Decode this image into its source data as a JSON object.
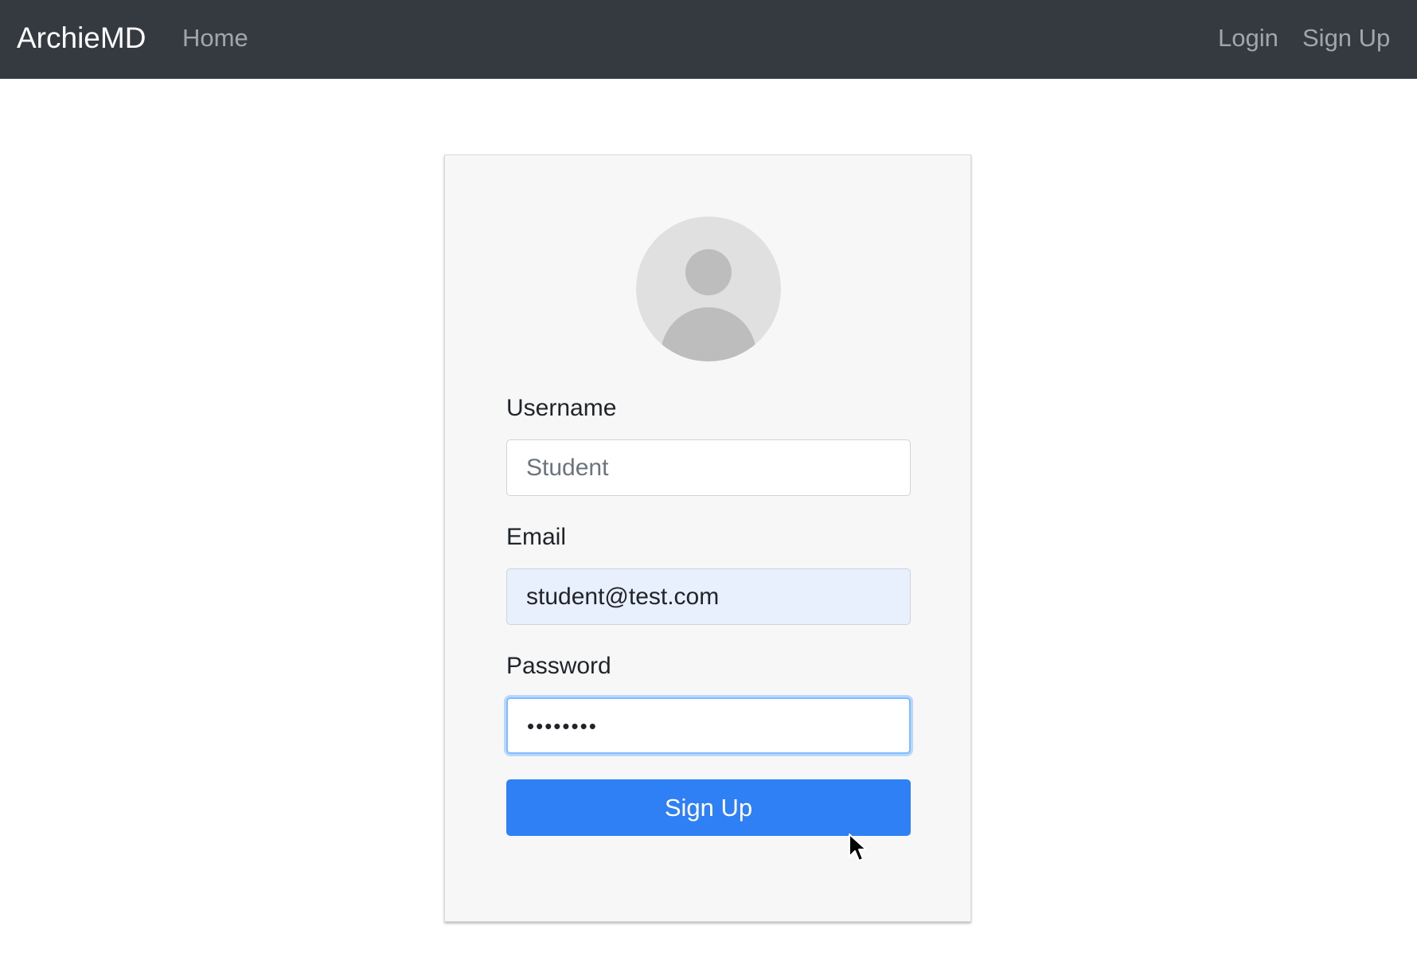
{
  "navbar": {
    "brand": "ArchieMD",
    "links": {
      "home": "Home",
      "login": "Login",
      "signup": "Sign Up"
    }
  },
  "signup_form": {
    "avatar": "user-avatar-placeholder",
    "username": {
      "label": "Username",
      "value": "Student"
    },
    "email": {
      "label": "Email",
      "value": "student@test.com"
    },
    "password": {
      "label": "Password",
      "value": "••••••••"
    },
    "submit_label": "Sign Up"
  },
  "colors": {
    "navbar_bg": "#343a40",
    "primary_button": "#2f7ff5",
    "autofill_bg": "#e8f0fe",
    "focus_border": "#80bdff"
  },
  "icons": {
    "pointer": "mouse-pointer-icon"
  }
}
